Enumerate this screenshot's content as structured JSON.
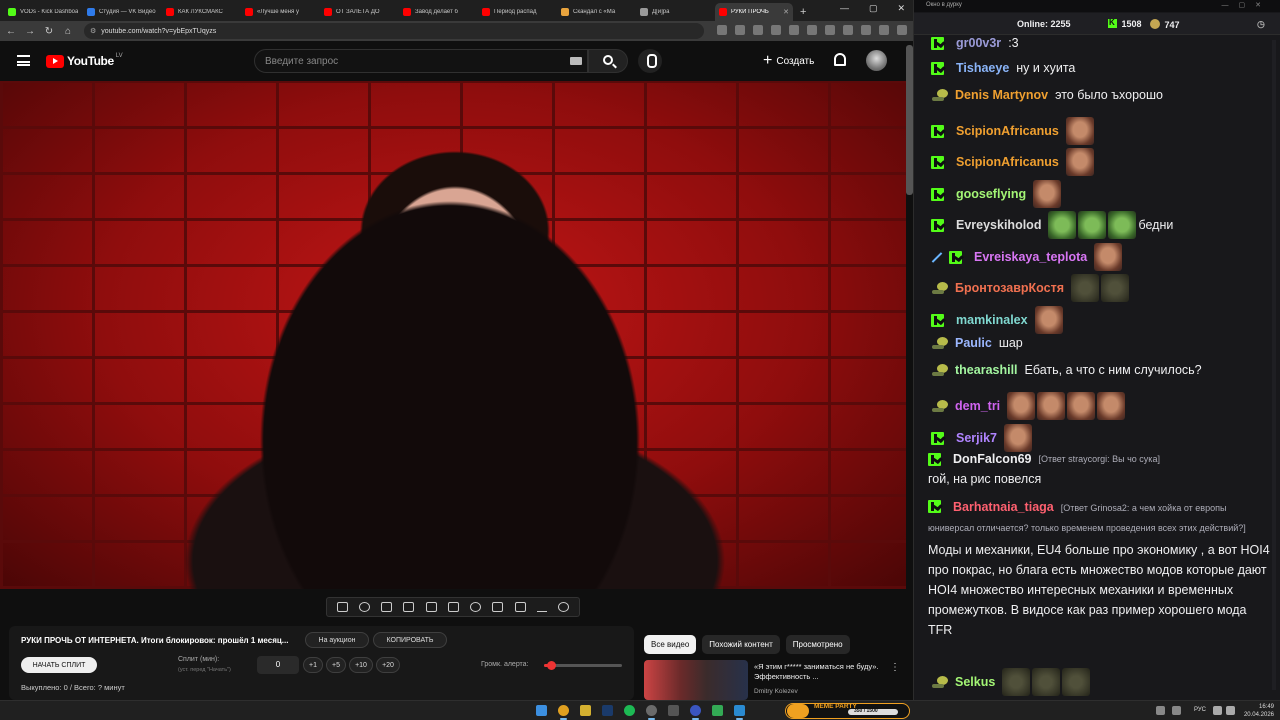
{
  "browser": {
    "tabs": [
      {
        "label": "VODs - Kick Dashboard",
        "color": "#53fc18"
      },
      {
        "label": "Студия — VK Видео",
        "color": "#2f7bea"
      },
      {
        "label": "КАК ЛУКСМАКС",
        "color": "#ff0000"
      },
      {
        "label": "«Лучше меня у",
        "color": "#ff0000"
      },
      {
        "label": "ОТ ЗАЛЕТА ДО",
        "color": "#ff0000"
      },
      {
        "label": "Завод делает б",
        "color": "#ff0000"
      },
      {
        "label": "Период распад",
        "color": "#ff0000"
      },
      {
        "label": "Скандал с «Ма",
        "color": "#e8a33d"
      },
      {
        "label": "Д[и]ра",
        "color": "#999999"
      },
      {
        "label": "РУКИ ПРОЧЬ",
        "color": "#ff0000",
        "active": true
      }
    ],
    "url": "youtube.com/watch?v=ybEpxTUqyzs"
  },
  "youtube": {
    "logo_text": "YouTube",
    "country": "LV",
    "search_placeholder": "Введите запрос",
    "create_label": "Создать"
  },
  "extension": {
    "video_title": "РУКИ ПРОЧЬ ОТ ИНТЕРНЕТА. Итоги блокировок: прошёл 1 месяц...",
    "auction_button": "На аукцион",
    "copy_button": "КОПИРОВАТЬ",
    "start_split_button": "НАЧАТЬ СПЛИТ",
    "split_label": "Сплит (мин):",
    "split_hint": "(уст. перед \"Начать\")",
    "split_value": "0",
    "increments": [
      "+1",
      "+5",
      "+10",
      "+20"
    ],
    "alert_volume_label": "Громк. алерта:",
    "alert_volume_fraction": 0.06,
    "bought_text": "Выкуплено: 0 / Всего: ? минут"
  },
  "related": {
    "chips": [
      {
        "label": "Все видео",
        "active": true
      },
      {
        "label": "Похожий контент",
        "active": false
      },
      {
        "label": "Просмотрено",
        "active": false
      }
    ],
    "video": {
      "title": "«Я этим г***** заниматься не буду». Эффективность ...",
      "channel": "Dmitry Kolezev"
    }
  },
  "chat_window": {
    "title": "Окно в дурку",
    "online_label": "Online:",
    "online_count": "2255",
    "kick_count": "1508",
    "coin_count": "747"
  },
  "chat": [
    {
      "badge": "kick",
      "user": "gr00v3r",
      "color": "#9b9bd8",
      "text": ":3"
    },
    {
      "badge": "kick",
      "user": "Tishaeye",
      "color": "#8ab4f8",
      "text": "ну и хуита"
    },
    {
      "badge": "frog",
      "user": "Denis Martynov",
      "color": "#f0a030",
      "text": "это было ъхорошо"
    },
    {
      "badge": "kick",
      "user": "ScipionAfricanus",
      "color": "#f0a030",
      "text": "",
      "emotes": [
        "face"
      ]
    },
    {
      "badge": "kick",
      "user": "ScipionAfricanus",
      "color": "#f0a030",
      "text": "",
      "emotes": [
        "face"
      ]
    },
    {
      "badge": "kick",
      "user": "gooseflying",
      "color": "#a3f575",
      "text": "",
      "emotes": [
        "face"
      ]
    },
    {
      "badge": "kick",
      "user": "Evreyskiholod",
      "color": "#dddddd",
      "text": "бедни",
      "emotes": [
        "frog",
        "frog",
        "frog"
      ]
    },
    {
      "badge": "sword-kick",
      "user": "Evreiskaya_teplota",
      "color": "#d876f4",
      "text": "",
      "emotes": [
        "face"
      ]
    },
    {
      "badge": "frog",
      "user": "БронтозаврКостя",
      "color": "#f07050",
      "text": "",
      "emotes": [
        "blob",
        "blob"
      ]
    },
    {
      "badge": "kick",
      "user": "mamkinalex",
      "color": "#80d8d0",
      "text": "",
      "emotes": [
        "face"
      ]
    },
    {
      "badge": "frog",
      "user": "Paulic",
      "color": "#9bb7ff",
      "text": "шар"
    },
    {
      "badge": "frog",
      "user": "thearashill",
      "color": "#a3f5a0",
      "text": "Ебать, а что с ним случилось?"
    },
    {
      "badge": "frog",
      "user": "dem_tri",
      "color": "#d064f0",
      "text": "",
      "emotes": [
        "face",
        "face",
        "face",
        "face"
      ]
    },
    {
      "badge": "kick",
      "user": "Serjik7",
      "color": "#b084ff",
      "text": "",
      "emotes": [
        "face"
      ]
    },
    {
      "badge": "kick",
      "user": "DonFalcon69",
      "color": "#efeff1",
      "reply": "[Ответ straycorgi: Вы чо сука]",
      "body": "гой, на рис повелся"
    },
    {
      "badge": "kick",
      "user": "Barhatnaia_tiaga",
      "color": "#ff6070",
      "reply": "[Ответ Grinosa2: а чем хойка от европы юниверсал отличается? только временем проведения всех этих действий?]",
      "body": "Моды и механики, EU4 больше про экономику , а вот HOI4 про покрас, но блага есть множество модов которые дают HOI4 множество интересных механики и временных промежутков. В видосе как раз пример хорошего мода TFR"
    },
    {
      "badge": "frog",
      "user": "Selkus",
      "color": "#a3f575",
      "text": "",
      "emotes": [
        "blob",
        "blob",
        "blob"
      ]
    }
  ],
  "taskbar": {
    "widget_name": "MEME PARTY",
    "widget_progress": "350 / 1500",
    "lang": "РУС",
    "time": "16:49",
    "date": "20.04.2026"
  }
}
